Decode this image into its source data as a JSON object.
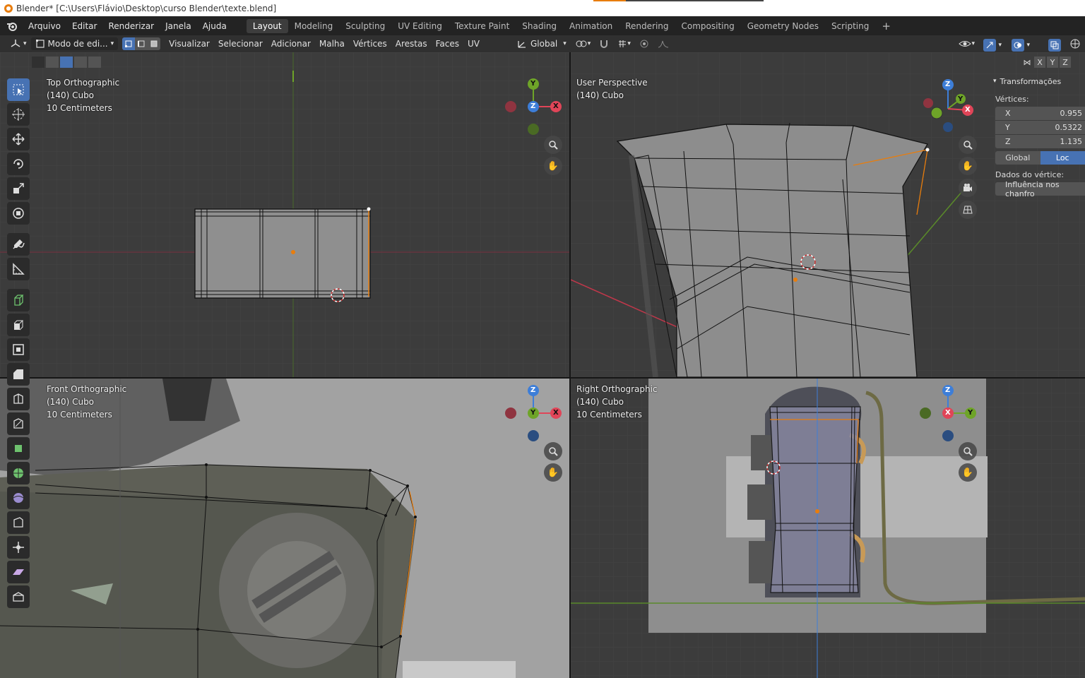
{
  "window": {
    "title": "Blender* [C:\\Users\\Flávio\\Desktop\\curso Blender\\texte.blend]"
  },
  "menu": [
    "Arquivo",
    "Editar",
    "Renderizar",
    "Janela",
    "Ajuda"
  ],
  "workspaces": [
    "Layout",
    "Modeling",
    "Sculpting",
    "UV Editing",
    "Texture Paint",
    "Shading",
    "Animation",
    "Rendering",
    "Compositing",
    "Geometry Nodes",
    "Scripting"
  ],
  "active_workspace": "Layout",
  "header": {
    "mode": "Modo de edi...",
    "menus": [
      "Visualizar",
      "Selecionar",
      "Adicionar",
      "Malha",
      "Vértices",
      "Arestas",
      "Faces",
      "UV"
    ],
    "transform_orientation": "Global",
    "axes": [
      "X",
      "Y",
      "Z"
    ]
  },
  "viewports": {
    "top": {
      "line1": "Top Orthographic",
      "line2": "(140) Cubo",
      "line3": "10 Centimeters"
    },
    "persp": {
      "line1": "User Perspective",
      "line2": "(140) Cubo"
    },
    "front": {
      "line1": "Front Orthographic",
      "line2": "(140) Cubo",
      "line3": "10 Centimeters"
    },
    "right": {
      "line1": "Right Orthographic",
      "line2": "(140) Cubo",
      "line3": "10 Centimeters"
    }
  },
  "gizmo_labels": {
    "x": "X",
    "y": "Y",
    "z": "Z"
  },
  "npanel": {
    "section": "Transformações",
    "vertices_label": "Vértices:",
    "x_label": "X",
    "x_value": "0.955",
    "y_label": "Y",
    "y_value": "0.5322",
    "z_label": "Z",
    "z_value": "1.135",
    "global_btn": "Global",
    "local_btn": "Loc",
    "vertex_data_label": "Dados do vértice:",
    "bevel_weight": "Influência nos chanfro"
  },
  "colors": {
    "accent": "#4772b3",
    "x_axis": "#e04558",
    "y_axis": "#6ea428",
    "z_axis": "#3d7ed8",
    "selection": "#e87d0d"
  }
}
